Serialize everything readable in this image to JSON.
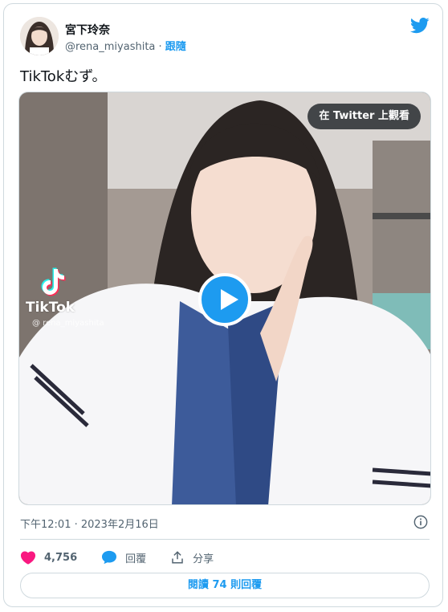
{
  "author": {
    "name": "宮下玲奈",
    "handle": "@rena_miyashita",
    "separator": " · ",
    "follow_label": "跟隨"
  },
  "tweet": {
    "text": "TikTokむず。",
    "timestamp": "下午12:01 · 2023年2月16日"
  },
  "media": {
    "watch_label": "在 Twitter 上觀看",
    "overlay_brand": "TikTok",
    "overlay_user": "@ rena_miyashita"
  },
  "actions": {
    "likes": "4,756",
    "reply_label": "回覆",
    "share_label": "分享"
  },
  "read_replies": {
    "prefix": "閱讀 ",
    "count": "74",
    "suffix": " 則回覆"
  },
  "colors": {
    "brand_blue": "#1d9bf0",
    "like_pink": "#f91880",
    "muted": "#536471",
    "border": "#cfd9de"
  },
  "icons": [
    "twitter-bird-icon",
    "play-icon",
    "heart-icon",
    "reply-bubble-icon",
    "share-icon",
    "info-icon",
    "tiktok-logo-icon"
  ]
}
